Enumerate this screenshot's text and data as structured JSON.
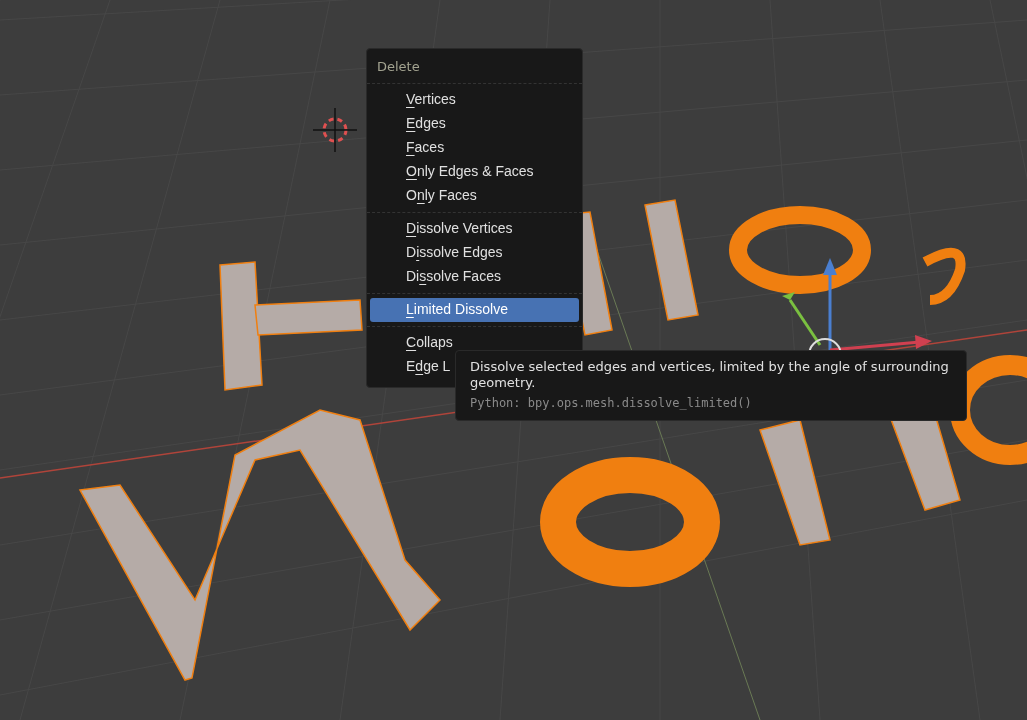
{
  "menu": {
    "title": "Delete",
    "sections": [
      {
        "items": [
          {
            "key": "V",
            "post": "ertices",
            "selected": false
          },
          {
            "key": "E",
            "post": "dges",
            "selected": false
          },
          {
            "key": "F",
            "post": "aces",
            "selected": false
          },
          {
            "key": "O",
            "post": "nly Edges & Faces",
            "selected": false
          },
          {
            "pre": "O",
            "key": "n",
            "post": "ly Faces",
            "selected": false
          }
        ]
      },
      {
        "items": [
          {
            "key": "D",
            "post": "issolve Vertices",
            "selected": false
          },
          {
            "pre": "D",
            "key": "i",
            "post": "ssolve Edges",
            "selected": false
          },
          {
            "pre": "Di",
            "key": "s",
            "post": "solve Faces",
            "selected": false
          }
        ]
      },
      {
        "items": [
          {
            "key": "L",
            "post": "imited Dissolve",
            "selected": true
          }
        ]
      },
      {
        "items": [
          {
            "key": "C",
            "post": "ollaps",
            "selected": false
          },
          {
            "pre": "E",
            "key": "d",
            "post": "ge L",
            "selected": false
          }
        ]
      }
    ]
  },
  "tooltip": {
    "description": "Dissolve selected edges and vertices, limited by the angle of surrounding geometry.",
    "python": "Python: bpy.ops.mesh.dissolve_limited()"
  }
}
